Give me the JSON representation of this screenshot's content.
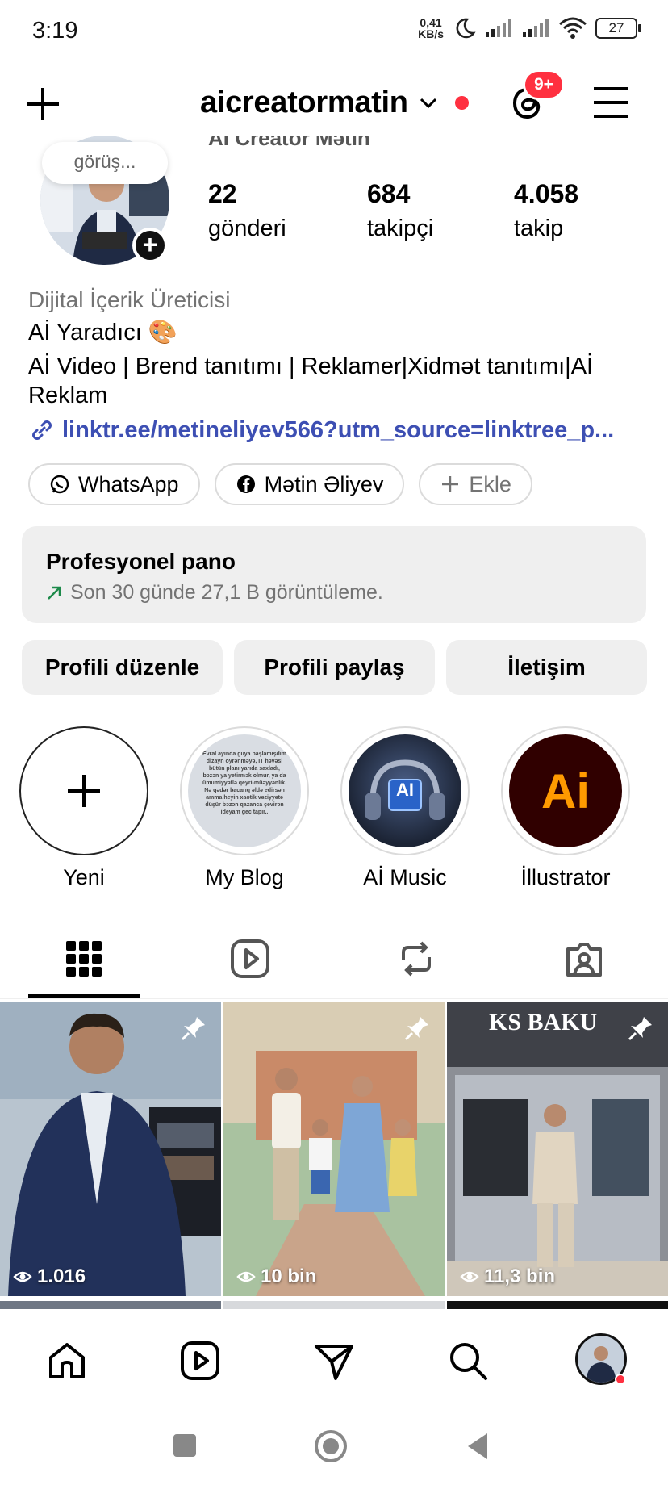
{
  "status_bar": {
    "time": "3:19",
    "speed_value": "0,41",
    "speed_unit": "KB/s",
    "battery": "27"
  },
  "header": {
    "username": "aicreatormatin",
    "notification_badge": "9+",
    "icons": [
      "plus-icon",
      "chevron-down-icon",
      "threads-icon",
      "menu-icon"
    ],
    "accent_color": "#ff3040"
  },
  "profile": {
    "note": "görüş...",
    "full_name_partial": "Aİ Creator Mətin",
    "stats": [
      {
        "value": "22",
        "label": "gönderi"
      },
      {
        "value": "684",
        "label": "takipçi"
      },
      {
        "value": "4.058",
        "label": "takip"
      }
    ],
    "category": "Dijital İçerik Üreticisi",
    "bio_line1": "Aİ Yaradıcı 🎨",
    "bio_line2": "Aİ Video | Brend tanıtımı | Reklamer|Xidmət tanıtımı|Aİ Reklam",
    "link": "linktr.ee/metineliyev566?utm_source=linktree_p...",
    "link_color": "#3d4fb3"
  },
  "chips": [
    {
      "label": "WhatsApp",
      "icon": "whatsapp-icon"
    },
    {
      "label": "Mətin Əliyev",
      "icon": "facebook-icon"
    },
    {
      "label": "Ekle",
      "icon": "plus-icon"
    }
  ],
  "dashboard": {
    "title": "Profesyonel pano",
    "subtitle": "Son 30 günde 27,1 B görüntüleme."
  },
  "actions": [
    "Profili düzenle",
    "Profili paylaş",
    "İletişim"
  ],
  "highlights": [
    {
      "label": "Yeni"
    },
    {
      "label": "My Blog",
      "cover_text": "Evral ayında guya başlamışdım dizayn öyrənməyə, IT həvəsi bütün planı yarıda saxladı, bəzən ya yetirmək olmur, ya da ümumiyyətlə qeyri-müəyyənlik. Nə qədər bacarıq əldə edirsən amma heyin xaotik vəziyyətə düşür bəzən qazanca çevirən ideyam gec tapır.."
    },
    {
      "label": "Aİ Music",
      "cover_text": "AI"
    },
    {
      "label": "İllustrator",
      "cover_text": "Ai"
    }
  ],
  "tabs": [
    "grid-icon",
    "reels-icon",
    "reposts-icon",
    "tagged-icon"
  ],
  "posts": [
    {
      "views": "1.016",
      "pinned": true
    },
    {
      "views": "10 bin",
      "pinned": true
    },
    {
      "views": "11,3 bin",
      "pinned": true,
      "sign_text": "KS BAKU"
    }
  ],
  "bottom_nav": [
    "home-icon",
    "reels-icon",
    "messages-icon",
    "search-icon",
    "profile-avatar"
  ]
}
